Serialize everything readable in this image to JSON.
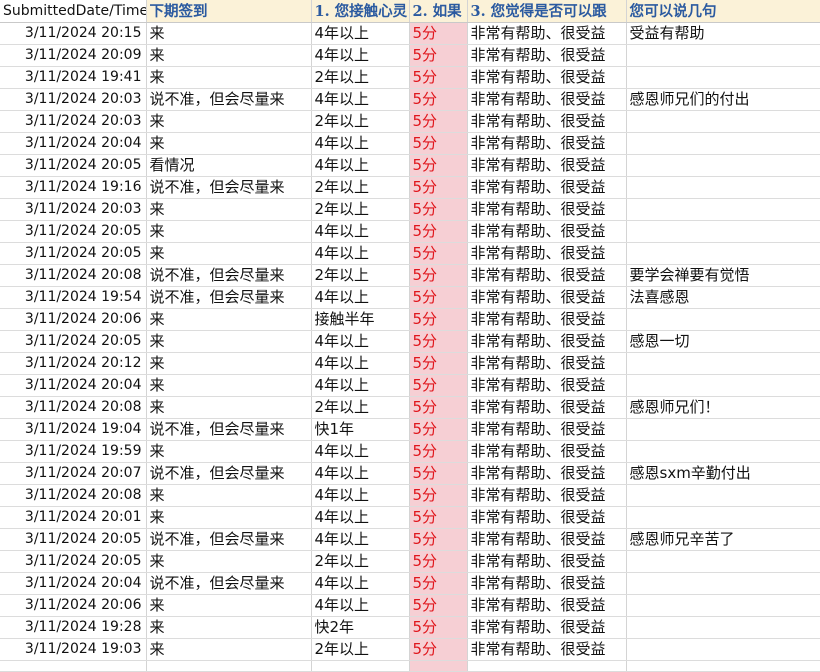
{
  "columns": [
    "SubmittedDate/Time",
    "下期签到",
    "1. 您接触心灵",
    "2. 如果",
    "3. 您觉得是否可以跟",
    "您可以说几句"
  ],
  "rows": [
    [
      "3/11/2024 20:15",
      "来",
      "4年以上",
      "5分",
      "非常有帮助、很受益",
      "受益有帮助"
    ],
    [
      "3/11/2024 20:09",
      "来",
      "4年以上",
      "5分",
      "非常有帮助、很受益",
      ""
    ],
    [
      "3/11/2024 19:41",
      "来",
      "2年以上",
      "5分",
      "非常有帮助、很受益",
      ""
    ],
    [
      "3/11/2024 20:03",
      "说不准，但会尽量来",
      "4年以上",
      "5分",
      "非常有帮助、很受益",
      "感恩师兄们的付出"
    ],
    [
      "3/11/2024 20:03",
      "来",
      "2年以上",
      "5分",
      "非常有帮助、很受益",
      ""
    ],
    [
      "3/11/2024 20:04",
      "来",
      "4年以上",
      "5分",
      "非常有帮助、很受益",
      ""
    ],
    [
      "3/11/2024 20:05",
      "看情况",
      "4年以上",
      "5分",
      "非常有帮助、很受益",
      ""
    ],
    [
      "3/11/2024 19:16",
      "说不准，但会尽量来",
      "2年以上",
      "5分",
      "非常有帮助、很受益",
      ""
    ],
    [
      "3/11/2024 20:03",
      "来",
      "2年以上",
      "5分",
      "非常有帮助、很受益",
      ""
    ],
    [
      "3/11/2024 20:05",
      "来",
      "4年以上",
      "5分",
      "非常有帮助、很受益",
      ""
    ],
    [
      "3/11/2024 20:05",
      "来",
      "4年以上",
      "5分",
      "非常有帮助、很受益",
      ""
    ],
    [
      "3/11/2024 20:08",
      "说不准，但会尽量来",
      "2年以上",
      "5分",
      "非常有帮助、很受益",
      "要学会禅要有觉悟"
    ],
    [
      "3/11/2024 19:54",
      "说不准，但会尽量来",
      "4年以上",
      "5分",
      "非常有帮助、很受益",
      "法喜感恩"
    ],
    [
      "3/11/2024 20:06",
      "来",
      "接触半年",
      "5分",
      "非常有帮助、很受益",
      ""
    ],
    [
      "3/11/2024 20:05",
      "来",
      "4年以上",
      "5分",
      "非常有帮助、很受益",
      "感恩一切"
    ],
    [
      "3/11/2024 20:12",
      "来",
      "4年以上",
      "5分",
      "非常有帮助、很受益",
      ""
    ],
    [
      "3/11/2024 20:04",
      "来",
      "4年以上",
      "5分",
      "非常有帮助、很受益",
      ""
    ],
    [
      "3/11/2024 20:08",
      "来",
      "2年以上",
      "5分",
      "非常有帮助、很受益",
      "感恩师兄们！"
    ],
    [
      "3/11/2024 19:04",
      "说不准，但会尽量来",
      "快1年",
      "5分",
      "非常有帮助、很受益",
      ""
    ],
    [
      "3/11/2024 19:59",
      "来",
      "4年以上",
      "5分",
      "非常有帮助、很受益",
      ""
    ],
    [
      "3/11/2024 20:07",
      "说不准，但会尽量来",
      "4年以上",
      "5分",
      "非常有帮助、很受益",
      "感恩sxm辛勤付出"
    ],
    [
      "3/11/2024 20:08",
      "来",
      "4年以上",
      "5分",
      "非常有帮助、很受益",
      ""
    ],
    [
      "3/11/2024 20:01",
      "来",
      "4年以上",
      "5分",
      "非常有帮助、很受益",
      ""
    ],
    [
      "3/11/2024 20:05",
      "说不准，但会尽量来",
      "4年以上",
      "5分",
      "非常有帮助、很受益",
      "感恩师兄辛苦了"
    ],
    [
      "3/11/2024 20:05",
      "来",
      "2年以上",
      "5分",
      "非常有帮助、很受益",
      ""
    ],
    [
      "3/11/2024 20:04",
      "说不准，但会尽量来",
      "4年以上",
      "5分",
      "非常有帮助、很受益",
      ""
    ],
    [
      "3/11/2024 20:06",
      "来",
      "4年以上",
      "5分",
      "非常有帮助、很受益",
      ""
    ],
    [
      "3/11/2024 19:28",
      "来",
      "快2年",
      "5分",
      "非常有帮助、很受益",
      ""
    ],
    [
      "3/11/2024 19:03",
      "来",
      "2年以上",
      "5分",
      "非常有帮助、很受益",
      ""
    ]
  ],
  "colors": {
    "header_bg": "#fbf2d8",
    "header_text": "#2b5aa0",
    "score_bg": "#f6cfd4",
    "score_text": "#e0161c"
  }
}
